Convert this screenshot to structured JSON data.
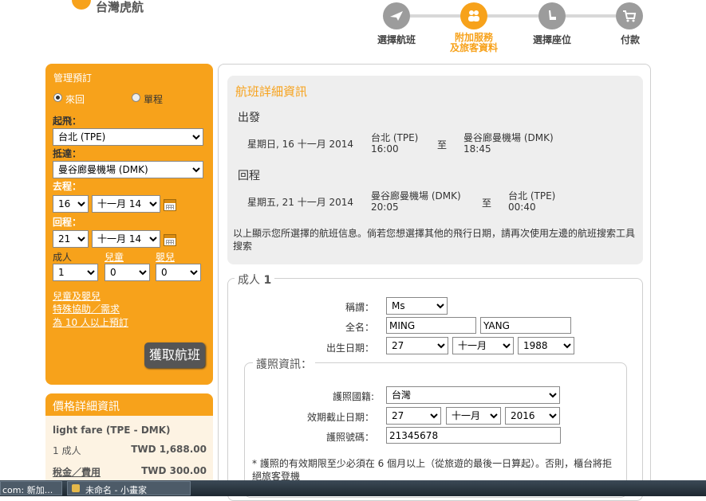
{
  "brand": {
    "name": "台灣虎航"
  },
  "steps": [
    {
      "label": "選擇航班",
      "icon": "airplane-icon",
      "active": false
    },
    {
      "label": "附加服務\n及旅客資料",
      "label1": "附加服務",
      "label2": "及旅客資料",
      "icon": "passengers-icon",
      "active": true
    },
    {
      "label": "選擇座位",
      "icon": "seat-icon",
      "active": false
    },
    {
      "label": "付款",
      "icon": "cart-icon",
      "active": false
    }
  ],
  "sidebar": {
    "title": "管理預訂",
    "trip_round": "來回",
    "trip_oneway": "單程",
    "from_label": "起飛：",
    "from_value": "台北 (TPE)",
    "to_label": "抵達：",
    "to_value": "曼谷廊曼機場 (DMK)",
    "depart_label": "去程：",
    "depart_day": "16",
    "depart_month": "十一月 14",
    "return_label": "回程：",
    "return_day": "21",
    "return_month": "十一月 14",
    "adult_label": "成人",
    "child_label": "兒童",
    "infant_label": "嬰兒",
    "adult_value": "1",
    "child_value": "0",
    "infant_value": "0",
    "link_children": "兒童及嬰兒",
    "link_special": "特殊協助／需求",
    "link_group": "為 10 人以上預訂",
    "search_button": "獲取航班"
  },
  "price": {
    "title": "價格詳細資訊",
    "fare_name": "light fare (TPE - DMK)",
    "adult_count": "1 成人",
    "adult_amount": "TWD 1,688.00",
    "tax_label": "稅金／費用",
    "tax_amount": "TWD 300.00"
  },
  "flight": {
    "title": "航班詳細資訊",
    "out_heading": "出發",
    "out_date": "星期日, 16 十一月 2014",
    "out_from": "台北 (TPE)",
    "out_dep_time": "16:00",
    "to_word": "至",
    "out_to": "曼谷廊曼機場 (DMK)",
    "out_arr_time": "18:45",
    "ret_heading": "回程",
    "ret_date": "星期五, 21 十一月 2014",
    "ret_from": "曼谷廊曼機場 (DMK)",
    "ret_dep_time": "20:05",
    "ret_to": "台北 (TPE)",
    "ret_arr_time": "00:40",
    "note": "以上顯示您所選擇的航班信息。倘若您想選擇其他的飛行日期，請再次使用左邊的航班搜索工具搜索"
  },
  "passenger": {
    "legend_prefix": "成人",
    "legend_number": "1",
    "title_label": "稱謂：",
    "title_value": "Ms",
    "name_label": "全名：",
    "first_name": "MING",
    "last_name": "YANG",
    "dob_label": "出生日期：",
    "dob_day": "27",
    "dob_month": "十一月",
    "dob_year": "1988",
    "passport_legend": "護照資訊：",
    "nationality_label": "護照國籍:",
    "nationality_value": "台灣",
    "expiry_label": "效期截止日期：",
    "expiry_day": "27",
    "expiry_month": "十一月",
    "expiry_year": "2016",
    "passport_no_label": "護照號碼：",
    "passport_no_value": "21345678",
    "passport_note": "* 護照的有效期限至少必須在 6 個月以上（從旅遊的最後一日算起）。否則，櫃台將拒絕旅客登機"
  },
  "taskbar": {
    "item1": "com: 新加...",
    "item2": "未命名 - 小畫家"
  },
  "colors": {
    "accent": "#f7a21b",
    "step_inactive": "#9c9c9c",
    "panel_grey": "#eeeeee"
  }
}
